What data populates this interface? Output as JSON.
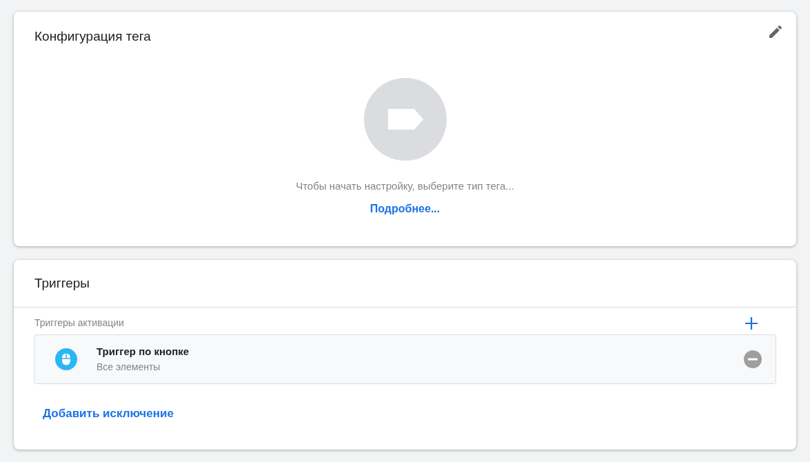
{
  "tag_config": {
    "title": "Конфигурация тега",
    "hint": "Чтобы начать настройку, выберите тип тега...",
    "link": "Подробнее..."
  },
  "triggers": {
    "title": "Триггеры",
    "section_label": "Триггеры активации",
    "items": [
      {
        "name": "Триггер по кнопке",
        "detail": "Все элементы"
      }
    ],
    "add_exception": "Добавить исключение"
  }
}
